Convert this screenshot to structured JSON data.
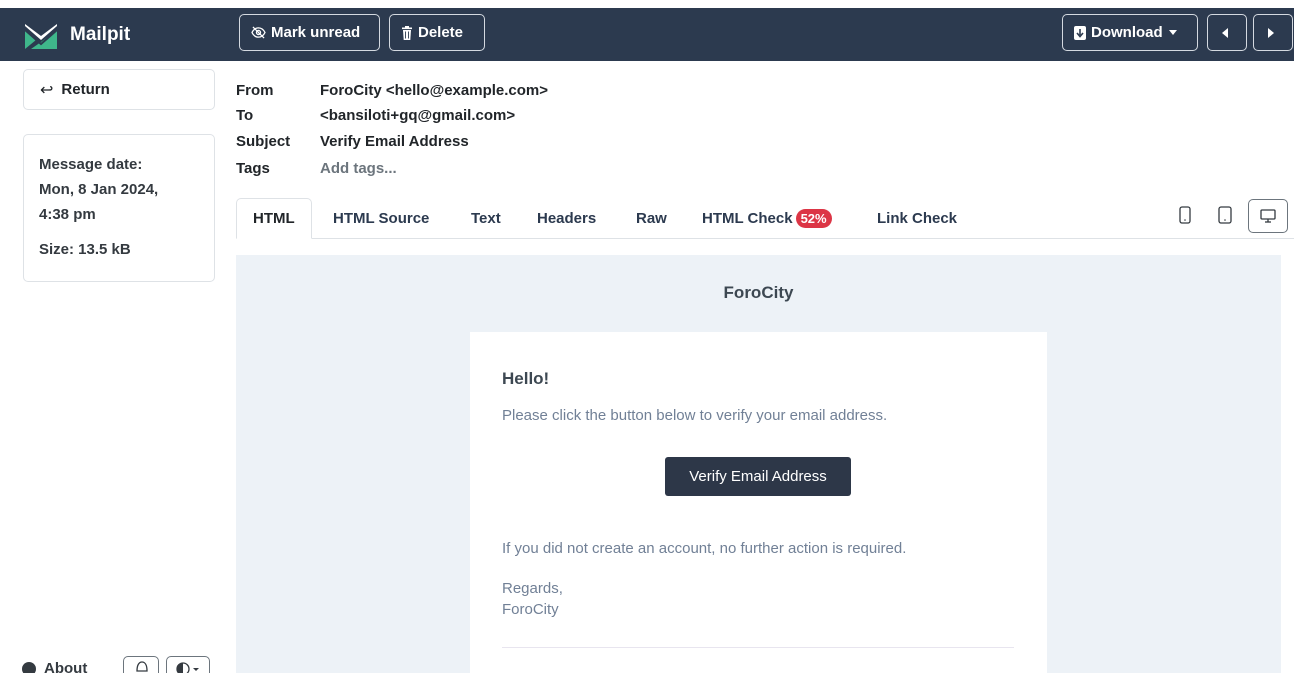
{
  "app": {
    "name": "Mailpit"
  },
  "toolbar": {
    "mark_unread": "Mark unread",
    "delete": "Delete",
    "download": "Download"
  },
  "sidebar": {
    "return": "Return",
    "message_date_label": "Message date:",
    "message_date_line1": "Mon, 8 Jan 2024,",
    "message_date_line2": "4:38 pm",
    "size": "Size: 13.5 kB",
    "about": "About"
  },
  "headers": {
    "from_label": "From",
    "from_value": "ForoCity <hello@example.com>",
    "to_label": "To",
    "to_value": "<bansiloti+gq@gmail.com>",
    "subject_label": "Subject",
    "subject_value": "Verify Email Address",
    "tags_label": "Tags",
    "tags_placeholder": "Add tags..."
  },
  "tabs": [
    {
      "label": "HTML"
    },
    {
      "label": "HTML Source"
    },
    {
      "label": "Text"
    },
    {
      "label": "Headers"
    },
    {
      "label": "Raw"
    },
    {
      "label": "HTML Check",
      "badge": "52%"
    },
    {
      "label": "Link Check"
    }
  ],
  "email": {
    "brand": "ForoCity",
    "greeting": "Hello!",
    "intro": "Please click the button below to verify your email address.",
    "button": "Verify Email Address",
    "outro": "If you did not create an account, no further action is required.",
    "regards": "Regards,",
    "signature": "ForoCity"
  },
  "colors": {
    "navbar": "#2c3a4f",
    "badge": "#dc3545",
    "email_bg": "#edf2f7",
    "email_button": "#2d3748"
  }
}
